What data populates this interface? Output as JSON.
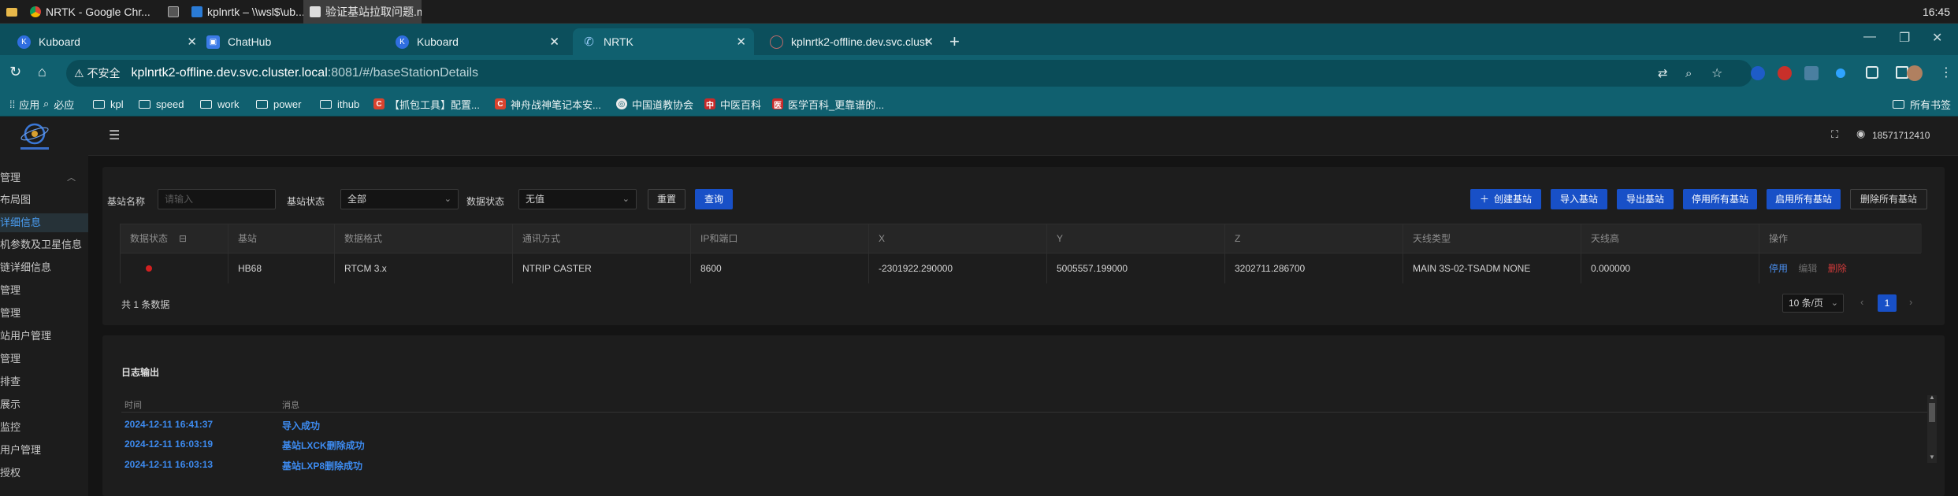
{
  "taskbar": {
    "items": [
      {
        "label": "NRTK - Google Chr..."
      },
      {
        "label": "kplnrtk – \\\\wsl$\\ub..."
      },
      {
        "label": "验证基站拉取问题.m..."
      }
    ],
    "clock": "16:45"
  },
  "tabs": [
    {
      "label": "Kuboard",
      "icon": "kuboard-icon"
    },
    {
      "label": "ChatHub",
      "icon": "chathub-icon"
    },
    {
      "label": "Kuboard",
      "icon": "kuboard-icon"
    },
    {
      "label": "NRTK",
      "icon": "phone-icon"
    },
    {
      "label": "kplnrtk2-offline.dev.svc.clust",
      "icon": "globe-icon"
    }
  ],
  "address": {
    "security": "不安全",
    "host": "kplnrtk2-offline.dev.svc.cluster.local",
    "path": ":8081/#/baseStationDetails"
  },
  "bookmarks": [
    {
      "label": "应用",
      "type": "apps"
    },
    {
      "label": "必应",
      "type": "search"
    },
    {
      "label": "kpl",
      "type": "folder"
    },
    {
      "label": "speed",
      "type": "folder"
    },
    {
      "label": "work",
      "type": "folder"
    },
    {
      "label": "power",
      "type": "folder"
    },
    {
      "label": "ithub",
      "type": "folder"
    },
    {
      "label": "【抓包工具】配置...",
      "type": "site"
    },
    {
      "label": "神舟战神笔记本安...",
      "type": "site"
    },
    {
      "label": "中国道教协会",
      "type": "site"
    },
    {
      "label": "中医百科",
      "type": "site"
    },
    {
      "label": "医学百科_更靠谱的...",
      "type": "site"
    },
    {
      "label": "所有书签",
      "type": "folder"
    }
  ],
  "sidebar": {
    "items": [
      {
        "label": "管理"
      },
      {
        "label": "布局图"
      },
      {
        "label": "详细信息"
      },
      {
        "label": "机参数及卫星信息"
      },
      {
        "label": "链详细信息"
      },
      {
        "label": "管理"
      },
      {
        "label": "管理"
      },
      {
        "label": "站用户管理"
      },
      {
        "label": "管理"
      },
      {
        "label": "排查"
      },
      {
        "label": "展示"
      },
      {
        "label": "监控"
      },
      {
        "label": "用户管理"
      },
      {
        "label": "授权"
      }
    ]
  },
  "header": {
    "user": "18571712410"
  },
  "filters": {
    "station_name_label": "基站名称",
    "station_name_placeholder": "请输入",
    "station_status_label": "基站状态",
    "station_status_value": "全部",
    "data_status_label": "数据状态",
    "data_status_value": "无值",
    "reset": "重置",
    "query": "查询"
  },
  "actions": {
    "create": "创建基站",
    "import": "导入基站",
    "export": "导出基站",
    "disable_all": "停用所有基站",
    "enable_all": "启用所有基站",
    "delete_all": "删除所有基站"
  },
  "table": {
    "columns": [
      "数据状态",
      "基站",
      "数据格式",
      "通讯方式",
      "IP和端口",
      "X",
      "Y",
      "Z",
      "天线类型",
      "天线高",
      "操作"
    ],
    "rows": [
      {
        "status_color": "#d22020",
        "station": "HB68",
        "format": "RTCM 3.x",
        "comm": "NTRIP CASTER",
        "ip_port": "8600",
        "x": "-2301922.290000",
        "y": "5005557.199000",
        "z": "3202711.286700",
        "antenna": "MAIN 3S-02-TSADM NONE",
        "height": "0.000000",
        "ops": [
          "停用",
          "编辑",
          "删除"
        ]
      }
    ]
  },
  "pagination": {
    "total": "共 1 条数据",
    "page_size": "10 条/页",
    "current": "1"
  },
  "log": {
    "title": "日志输出",
    "col_time": "时间",
    "col_msg": "消息",
    "rows": [
      {
        "time": "2024-12-11 16:41:37",
        "msg": "导入成功"
      },
      {
        "time": "2024-12-11 16:03:19",
        "msg": "基站LXCK删除成功"
      },
      {
        "time": "2024-12-11 16:03:13",
        "msg": "基站LXP8删除成功"
      }
    ]
  }
}
